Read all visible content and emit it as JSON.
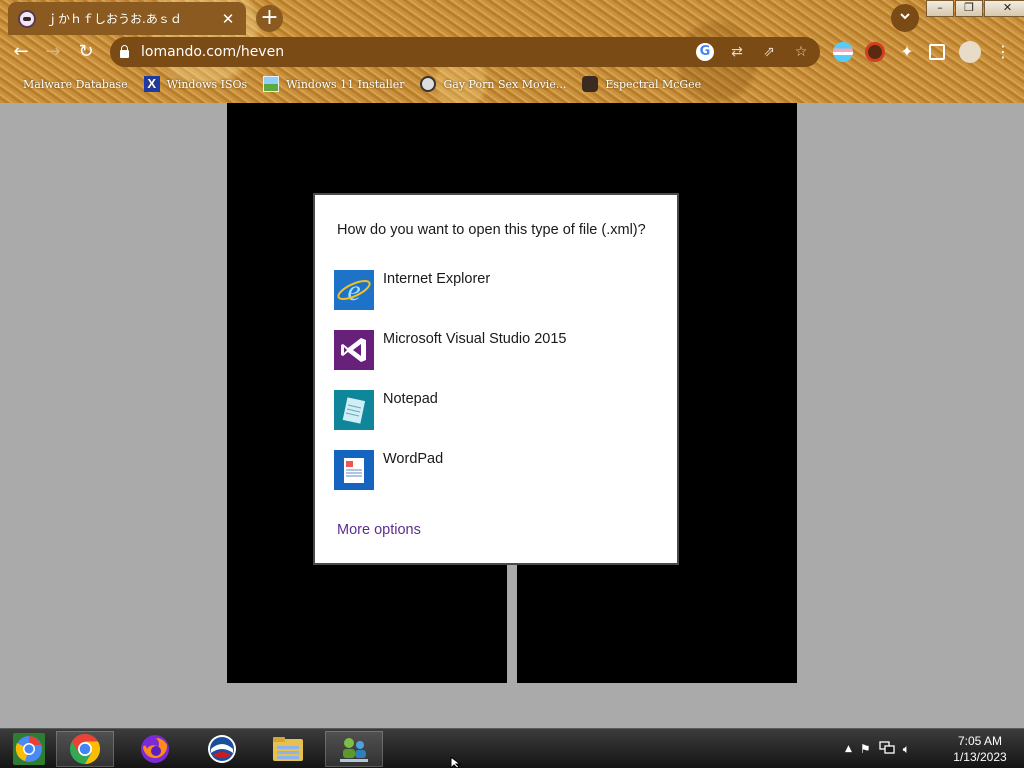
{
  "browser": {
    "tab_title": "ｊかｈｆしおうお.あｓｄ",
    "tab_close": "✕",
    "new_tab": "+",
    "url": "lomando.com/heven",
    "window_buttons": {
      "minimize": "–",
      "restore": "❐",
      "close": "✕"
    },
    "nav": {
      "back": "←",
      "forward": "→",
      "reload": "↻"
    },
    "omnibox_icons": [
      "google-icon",
      "translate-icon",
      "share-icon",
      "star-icon"
    ],
    "bookmarks": [
      {
        "label": "Malware Database",
        "icon": "folder-icon"
      },
      {
        "label": "Windows ISOs",
        "icon": "x-icon"
      },
      {
        "label": "Windows 11 Installer",
        "icon": "image-icon"
      },
      {
        "label": "Gay Porn Sex Movie...",
        "icon": "skull-icon"
      },
      {
        "label": "Espectral McGee",
        "icon": "avatar-icon"
      }
    ]
  },
  "dialog": {
    "question": "How do you want to open this type of file (.xml)?",
    "apps": [
      {
        "name": "Internet Explorer",
        "icon": "internet-explorer-icon"
      },
      {
        "name": "Microsoft Visual Studio 2015",
        "icon": "visual-studio-icon"
      },
      {
        "name": "Notepad",
        "icon": "notepad-icon"
      },
      {
        "name": "WordPad",
        "icon": "wordpad-icon"
      }
    ],
    "more_options": "More options"
  },
  "taskbar": {
    "apps": [
      "chromium-icon",
      "chrome-icon",
      "firefox-icon",
      "opera-icon",
      "file-explorer-icon",
      "network-users-icon"
    ],
    "tray_icons": [
      "chevron-up-icon",
      "flag-icon",
      "network-icon",
      "volume-icon"
    ],
    "time": "7:05 AM",
    "date": "1/13/2023"
  }
}
